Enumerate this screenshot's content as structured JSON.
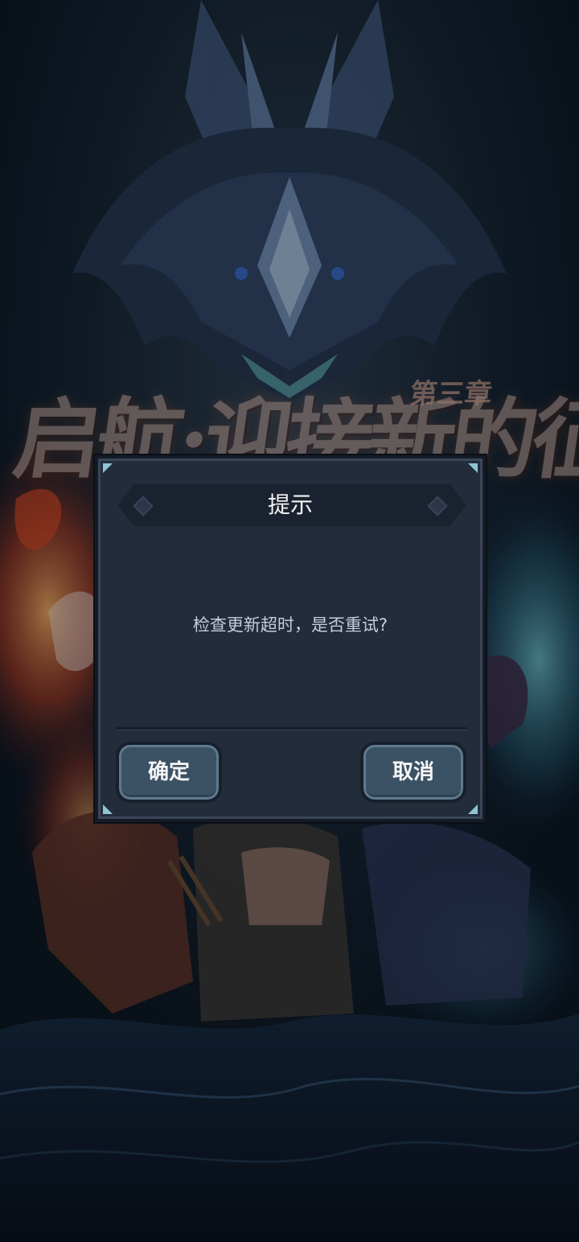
{
  "background": {
    "title_text": "启航·迎接新的征程",
    "chapter_text": "第三章"
  },
  "dialog": {
    "title": "提示",
    "message": "检查更新超时，是否重试?",
    "confirm_label": "确定",
    "cancel_label": "取消"
  },
  "colors": {
    "dialog_bg": "#232c3b",
    "button_bg": "#3b5164",
    "corner_accent": "#8fc4d2"
  }
}
